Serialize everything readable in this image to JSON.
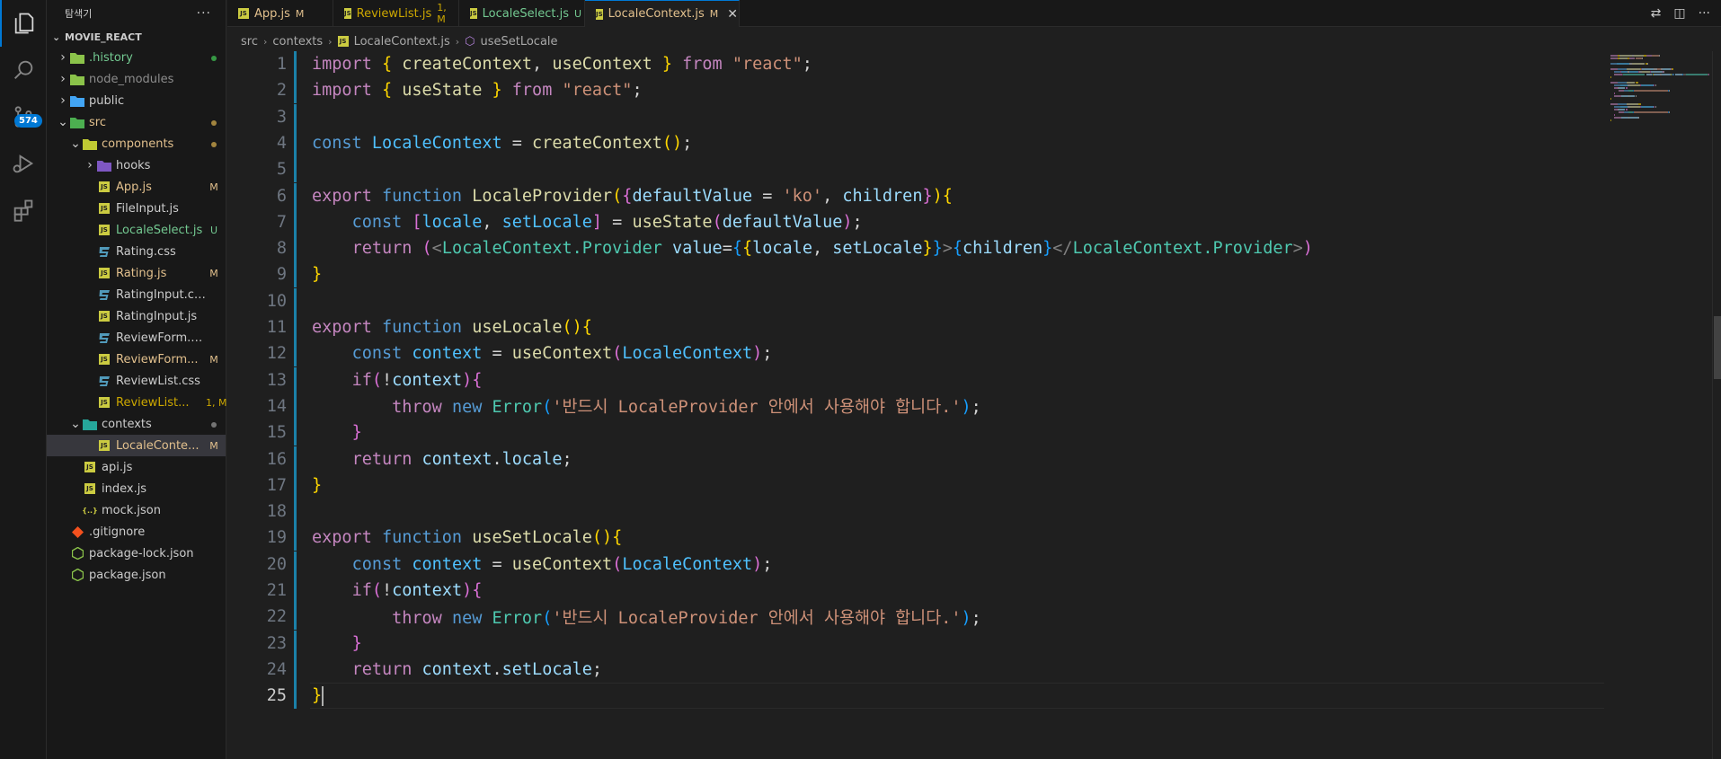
{
  "explorer": {
    "title": "탐색기",
    "more_label": "···",
    "project": "MOVIE_REACT",
    "items": [
      {
        "label": ".history",
        "kind": "folder",
        "chev": "›",
        "indent": 1,
        "status": "dot",
        "status_color": "#3fb950",
        "color": "#73c991",
        "icon": "folder-icon"
      },
      {
        "label": "node_modules",
        "kind": "folder",
        "chev": "›",
        "indent": 1,
        "status": "",
        "color": "#8c8c8c",
        "icon": "folder-icon"
      },
      {
        "label": "public",
        "kind": "folder",
        "chev": "›",
        "indent": 1,
        "status": "",
        "color": "#cccccc",
        "icon": "folder-icon"
      },
      {
        "label": "src",
        "kind": "folder",
        "chev": "⌄",
        "indent": 1,
        "status": "dot",
        "status_color": "#c5a048",
        "color": "#e2c08d",
        "icon": "folder-open-icon"
      },
      {
        "label": "components",
        "kind": "folder",
        "chev": "⌄",
        "indent": 2,
        "status": "dot",
        "status_color": "#c5a048",
        "color": "#e2c08d",
        "icon": "folder-open-icon"
      },
      {
        "label": "hooks",
        "kind": "folder",
        "chev": "›",
        "indent": 3,
        "status": "",
        "color": "#cccccc",
        "icon": "folder-icon"
      },
      {
        "label": "App.js",
        "kind": "js",
        "indent": 3,
        "status": "M",
        "color": "#e2c08d"
      },
      {
        "label": "FileInput.js",
        "kind": "js",
        "indent": 3,
        "status": "",
        "color": "#cccccc"
      },
      {
        "label": "LocaleSelect.js",
        "kind": "js",
        "indent": 3,
        "status": "U",
        "color": "#73c991"
      },
      {
        "label": "Rating.css",
        "kind": "css",
        "indent": 3,
        "status": "",
        "color": "#cccccc"
      },
      {
        "label": "Rating.js",
        "kind": "js",
        "indent": 3,
        "status": "M",
        "color": "#e2c08d"
      },
      {
        "label": "RatingInput.css",
        "kind": "css",
        "indent": 3,
        "status": "",
        "color": "#cccccc"
      },
      {
        "label": "RatingInput.js",
        "kind": "js",
        "indent": 3,
        "status": "",
        "color": "#cccccc"
      },
      {
        "label": "ReviewForm.css",
        "kind": "css",
        "indent": 3,
        "status": "",
        "color": "#cccccc"
      },
      {
        "label": "ReviewForm...",
        "kind": "js",
        "indent": 3,
        "status": "M",
        "color": "#e2c08d"
      },
      {
        "label": "ReviewList.css",
        "kind": "css",
        "indent": 3,
        "status": "",
        "color": "#cccccc"
      },
      {
        "label": "ReviewList...",
        "kind": "js",
        "indent": 3,
        "status": "1, M",
        "color": "#cca700"
      },
      {
        "label": "contexts",
        "kind": "folder",
        "chev": "⌄",
        "indent": 2,
        "status": "dot",
        "status_color": "#8c8c8c",
        "color": "#cccccc",
        "icon": "folder-open-icon"
      },
      {
        "label": "LocaleConte...",
        "kind": "js",
        "indent": 3,
        "status": "M",
        "color": "#e2c08d",
        "selected": true
      },
      {
        "label": "api.js",
        "kind": "js",
        "indent": 2,
        "status": "",
        "color": "#cccccc"
      },
      {
        "label": "index.js",
        "kind": "js",
        "indent": 2,
        "status": "",
        "color": "#cccccc"
      },
      {
        "label": "mock.json",
        "kind": "json",
        "indent": 2,
        "status": "",
        "color": "#cccccc"
      },
      {
        "label": ".gitignore",
        "kind": "git",
        "indent": 1,
        "status": "",
        "color": "#cccccc"
      },
      {
        "label": "package-lock.json",
        "kind": "npm",
        "indent": 1,
        "status": "",
        "color": "#cccccc"
      },
      {
        "label": "package.json",
        "kind": "npm",
        "indent": 1,
        "status": "",
        "color": "#cccccc"
      }
    ]
  },
  "activity": {
    "scm_badge": "574"
  },
  "tabs": [
    {
      "label": "App.js",
      "status": "M",
      "color": "#e2c08d",
      "active": false
    },
    {
      "label": "ReviewList.js",
      "status": "1, M",
      "color": "#cca700",
      "active": false
    },
    {
      "label": "LocaleSelect.js",
      "status": "U",
      "color": "#73c991",
      "active": false
    },
    {
      "label": "LocaleContext.js",
      "status": "M",
      "color": "#e2c08d",
      "active": true
    }
  ],
  "breadcrumb": {
    "parts": [
      "src",
      "contexts",
      "LocaleContext.js",
      "useSetLocale"
    ]
  },
  "editor": {
    "current_line": 25,
    "lines": [
      [
        [
          "kw",
          "import "
        ],
        [
          "br1",
          "{ "
        ],
        [
          "fn",
          "createContext"
        ],
        [
          "pl",
          ", "
        ],
        [
          "fn",
          "useContext"
        ],
        [
          "br1",
          " }"
        ],
        [
          "kw",
          " from "
        ],
        [
          "str",
          "\"react\""
        ],
        [
          "pl",
          ";"
        ]
      ],
      [
        [
          "kw",
          "import "
        ],
        [
          "br1",
          "{ "
        ],
        [
          "fn",
          "useState"
        ],
        [
          "br1",
          " }"
        ],
        [
          "kw",
          " from "
        ],
        [
          "str",
          "\"react\""
        ],
        [
          "pl",
          ";"
        ]
      ],
      [],
      [
        [
          "kwb",
          "const "
        ],
        [
          "cnst",
          "LocaleContext"
        ],
        [
          "pl",
          " = "
        ],
        [
          "fn",
          "createContext"
        ],
        [
          "br1",
          "()"
        ],
        [
          "pl",
          ";"
        ]
      ],
      [],
      [
        [
          "kw",
          "export "
        ],
        [
          "kwb",
          "function "
        ],
        [
          "fn",
          "LocaleProvider"
        ],
        [
          "br1",
          "("
        ],
        [
          "br2",
          "{"
        ],
        [
          "var",
          "defaultValue"
        ],
        [
          "pl",
          " = "
        ],
        [
          "str",
          "'ko'"
        ],
        [
          "pl",
          ", "
        ],
        [
          "var",
          "children"
        ],
        [
          "br2",
          "}"
        ],
        [
          "br1",
          ")"
        ],
        [
          "br1",
          "{"
        ]
      ],
      [
        [
          "pl",
          "    "
        ],
        [
          "kwb",
          "const "
        ],
        [
          "br2",
          "["
        ],
        [
          "cnst",
          "locale"
        ],
        [
          "pl",
          ", "
        ],
        [
          "cnst",
          "setLocale"
        ],
        [
          "br2",
          "]"
        ],
        [
          "pl",
          " = "
        ],
        [
          "fn",
          "useState"
        ],
        [
          "br2",
          "("
        ],
        [
          "var",
          "defaultValue"
        ],
        [
          "br2",
          ")"
        ],
        [
          "pl",
          ";"
        ]
      ],
      [
        [
          "pl",
          "    "
        ],
        [
          "kw",
          "return "
        ],
        [
          "br2",
          "("
        ],
        [
          "tagp",
          "<"
        ],
        [
          "tag",
          "LocaleContext.Provider"
        ],
        [
          "pl",
          " "
        ],
        [
          "var",
          "value"
        ],
        [
          "pl",
          "="
        ],
        [
          "br3",
          "{"
        ],
        [
          "br1",
          "{"
        ],
        [
          "var",
          "locale"
        ],
        [
          "pl",
          ", "
        ],
        [
          "var",
          "setLocale"
        ],
        [
          "br1",
          "}"
        ],
        [
          "br3",
          "}"
        ],
        [
          "tagp",
          ">"
        ],
        [
          "br3",
          "{"
        ],
        [
          "var",
          "children"
        ],
        [
          "br3",
          "}"
        ],
        [
          "tagp",
          "</"
        ],
        [
          "tag",
          "LocaleContext.Provider"
        ],
        [
          "tagp",
          ">"
        ],
        [
          "br2",
          ")"
        ]
      ],
      [
        [
          "br1",
          "}"
        ]
      ],
      [],
      [
        [
          "kw",
          "export "
        ],
        [
          "kwb",
          "function "
        ],
        [
          "fn",
          "useLocale"
        ],
        [
          "br1",
          "()"
        ],
        [
          "br1",
          "{"
        ]
      ],
      [
        [
          "pl",
          "    "
        ],
        [
          "kwb",
          "const "
        ],
        [
          "cnst",
          "context"
        ],
        [
          "pl",
          " = "
        ],
        [
          "fn",
          "useContext"
        ],
        [
          "br2",
          "("
        ],
        [
          "cnst",
          "LocaleContext"
        ],
        [
          "br2",
          ")"
        ],
        [
          "pl",
          ";"
        ]
      ],
      [
        [
          "pl",
          "    "
        ],
        [
          "kw",
          "if"
        ],
        [
          "br2",
          "("
        ],
        [
          "pl",
          "!"
        ],
        [
          "var",
          "context"
        ],
        [
          "br2",
          ")"
        ],
        [
          "br2",
          "{"
        ]
      ],
      [
        [
          "pl",
          "        "
        ],
        [
          "kw",
          "throw "
        ],
        [
          "kwb",
          "new "
        ],
        [
          "cls",
          "Error"
        ],
        [
          "br3",
          "("
        ],
        [
          "str",
          "'반드시 LocaleProvider 안에서 사용해야 합니다.'"
        ],
        [
          "br3",
          ")"
        ],
        [
          "pl",
          ";"
        ]
      ],
      [
        [
          "pl",
          "    "
        ],
        [
          "br2",
          "}"
        ]
      ],
      [
        [
          "pl",
          "    "
        ],
        [
          "kw",
          "return "
        ],
        [
          "var",
          "context"
        ],
        [
          "pl",
          "."
        ],
        [
          "var",
          "locale"
        ],
        [
          "pl",
          ";"
        ]
      ],
      [
        [
          "br1",
          "}"
        ]
      ],
      [],
      [
        [
          "kw",
          "export "
        ],
        [
          "kwb",
          "function "
        ],
        [
          "fn",
          "useSetLocale"
        ],
        [
          "br1",
          "()"
        ],
        [
          "br1",
          "{"
        ]
      ],
      [
        [
          "pl",
          "    "
        ],
        [
          "kwb",
          "const "
        ],
        [
          "cnst",
          "context"
        ],
        [
          "pl",
          " = "
        ],
        [
          "fn",
          "useContext"
        ],
        [
          "br2",
          "("
        ],
        [
          "cnst",
          "LocaleContext"
        ],
        [
          "br2",
          ")"
        ],
        [
          "pl",
          ";"
        ]
      ],
      [
        [
          "pl",
          "    "
        ],
        [
          "kw",
          "if"
        ],
        [
          "br2",
          "("
        ],
        [
          "pl",
          "!"
        ],
        [
          "var",
          "context"
        ],
        [
          "br2",
          ")"
        ],
        [
          "br2",
          "{"
        ]
      ],
      [
        [
          "pl",
          "        "
        ],
        [
          "kw",
          "throw "
        ],
        [
          "kwb",
          "new "
        ],
        [
          "cls",
          "Error"
        ],
        [
          "br3",
          "("
        ],
        [
          "str",
          "'반드시 LocaleProvider 안에서 사용해야 합니다.'"
        ],
        [
          "br3",
          ")"
        ],
        [
          "pl",
          ";"
        ]
      ],
      [
        [
          "pl",
          "    "
        ],
        [
          "br2",
          "}"
        ]
      ],
      [
        [
          "pl",
          "    "
        ],
        [
          "kw",
          "return "
        ],
        [
          "var",
          "context"
        ],
        [
          "pl",
          "."
        ],
        [
          "var",
          "setLocale"
        ],
        [
          "pl",
          ";"
        ]
      ],
      [
        [
          "br1",
          "}"
        ]
      ]
    ]
  }
}
